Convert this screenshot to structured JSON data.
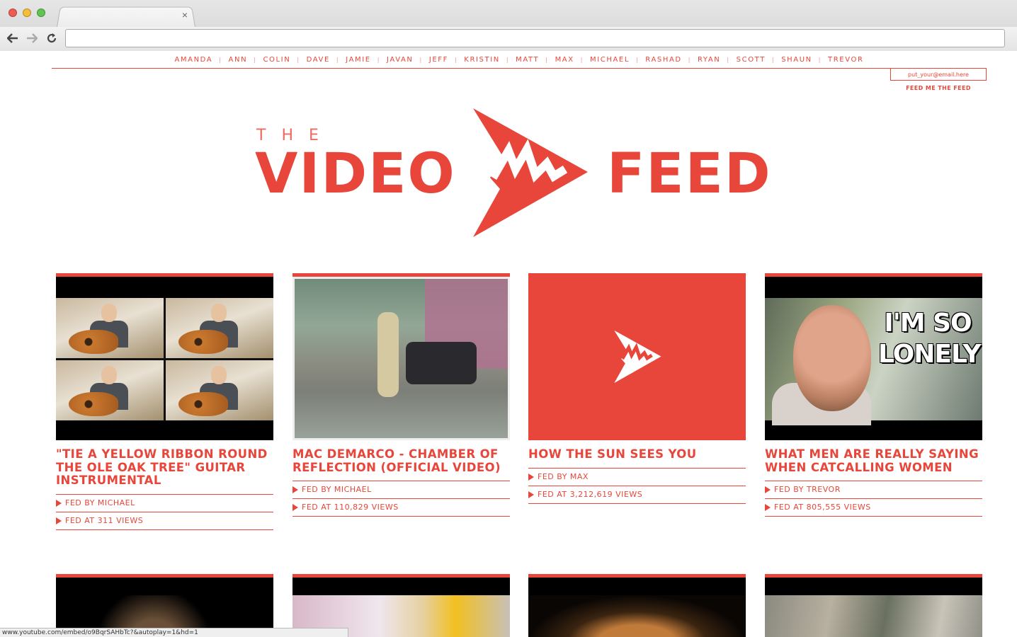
{
  "browser": {
    "tab_close": "×",
    "url": "",
    "status_url": "www.youtube.com/embed/o9BqrSAHbTc?&autoplay=1&hd=1"
  },
  "nav": {
    "items": [
      "AMANDA",
      "ANN",
      "COLIN",
      "DAVE",
      "JAMIE",
      "JAVAN",
      "JEFF",
      "KRISTIN",
      "MATT",
      "MAX",
      "MICHAEL",
      "RASHAD",
      "RYAN",
      "SCOTT",
      "SHAUN",
      "TREVOR"
    ],
    "separator": "|"
  },
  "subscribe": {
    "email_placeholder": "put_your@email.here",
    "button_label": "FEED ME THE FEED"
  },
  "logo": {
    "the": "THE",
    "video": "VIDEO",
    "feed": "FEED"
  },
  "colors": {
    "accent": "#e8463a"
  },
  "cards": [
    {
      "title": "\"TIE A YELLOW RIBBON ROUND THE OLE OAK TREE\" GUITAR INSTRUMENTAL",
      "fed_by": "FED BY MICHAEL",
      "fed_at": "FED AT 311 VIEWS",
      "thumb": "guitar-grid"
    },
    {
      "title": "MAC DEMARCO - CHAMBER OF REFLECTION (OFFICIAL VIDEO)",
      "fed_by": "FED BY MICHAEL",
      "fed_at": "FED AT 110,829 VIEWS",
      "thumb": "street"
    },
    {
      "title": "HOW THE SUN SEES YOU",
      "fed_by": "FED BY MAX",
      "fed_at": "FED AT 3,212,619 VIEWS",
      "thumb": "logo-placeholder"
    },
    {
      "title": "WHAT MEN ARE REALLY SAYING WHEN CATCALLING WOMEN",
      "fed_by": "FED BY TREVOR",
      "fed_at": "FED AT 805,555 VIEWS",
      "thumb": "lonely",
      "thumb_caption": "I'M SO LONELY"
    }
  ]
}
